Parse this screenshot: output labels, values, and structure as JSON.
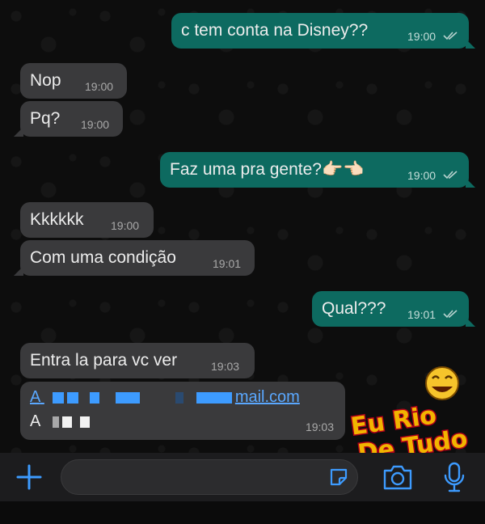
{
  "messages": [
    {
      "id": "m1",
      "direction": "out",
      "text": "c tem conta na Disney??",
      "time": "19:00"
    },
    {
      "id": "m2",
      "direction": "in",
      "text": "Nop",
      "time": "19:00"
    },
    {
      "id": "m3",
      "direction": "in",
      "text": "Pq?",
      "time": "19:00"
    },
    {
      "id": "m4",
      "direction": "out",
      "text": "Faz uma pra gente?👉🏻👈🏻",
      "time": "19:00"
    },
    {
      "id": "m5",
      "direction": "in",
      "text": "Kkkkkk",
      "time": "19:00"
    },
    {
      "id": "m6",
      "direction": "in",
      "text": "Com uma condição",
      "time": "19:01"
    },
    {
      "id": "m7",
      "direction": "out",
      "text": "Qual???",
      "time": "19:01"
    },
    {
      "id": "m8",
      "direction": "in",
      "text": "Entra la para vc ver",
      "time": "19:03"
    }
  ],
  "email_message": {
    "line1_prefix": "A",
    "line1_suffix": "mail.com",
    "line2_prefix": "A",
    "time": "19:03"
  },
  "watermark": {
    "line1": "Eu Rio",
    "line2": "De Tudo"
  },
  "input_bar": {
    "plus_icon": "plus-icon",
    "sticker_icon": "sticker-icon",
    "camera_icon": "camera-icon",
    "mic_icon": "microphone-icon"
  },
  "colors": {
    "outgoing_bubble": "#0d6a60",
    "incoming_bubble": "#3a3a3c",
    "accent": "#3d9bff"
  }
}
